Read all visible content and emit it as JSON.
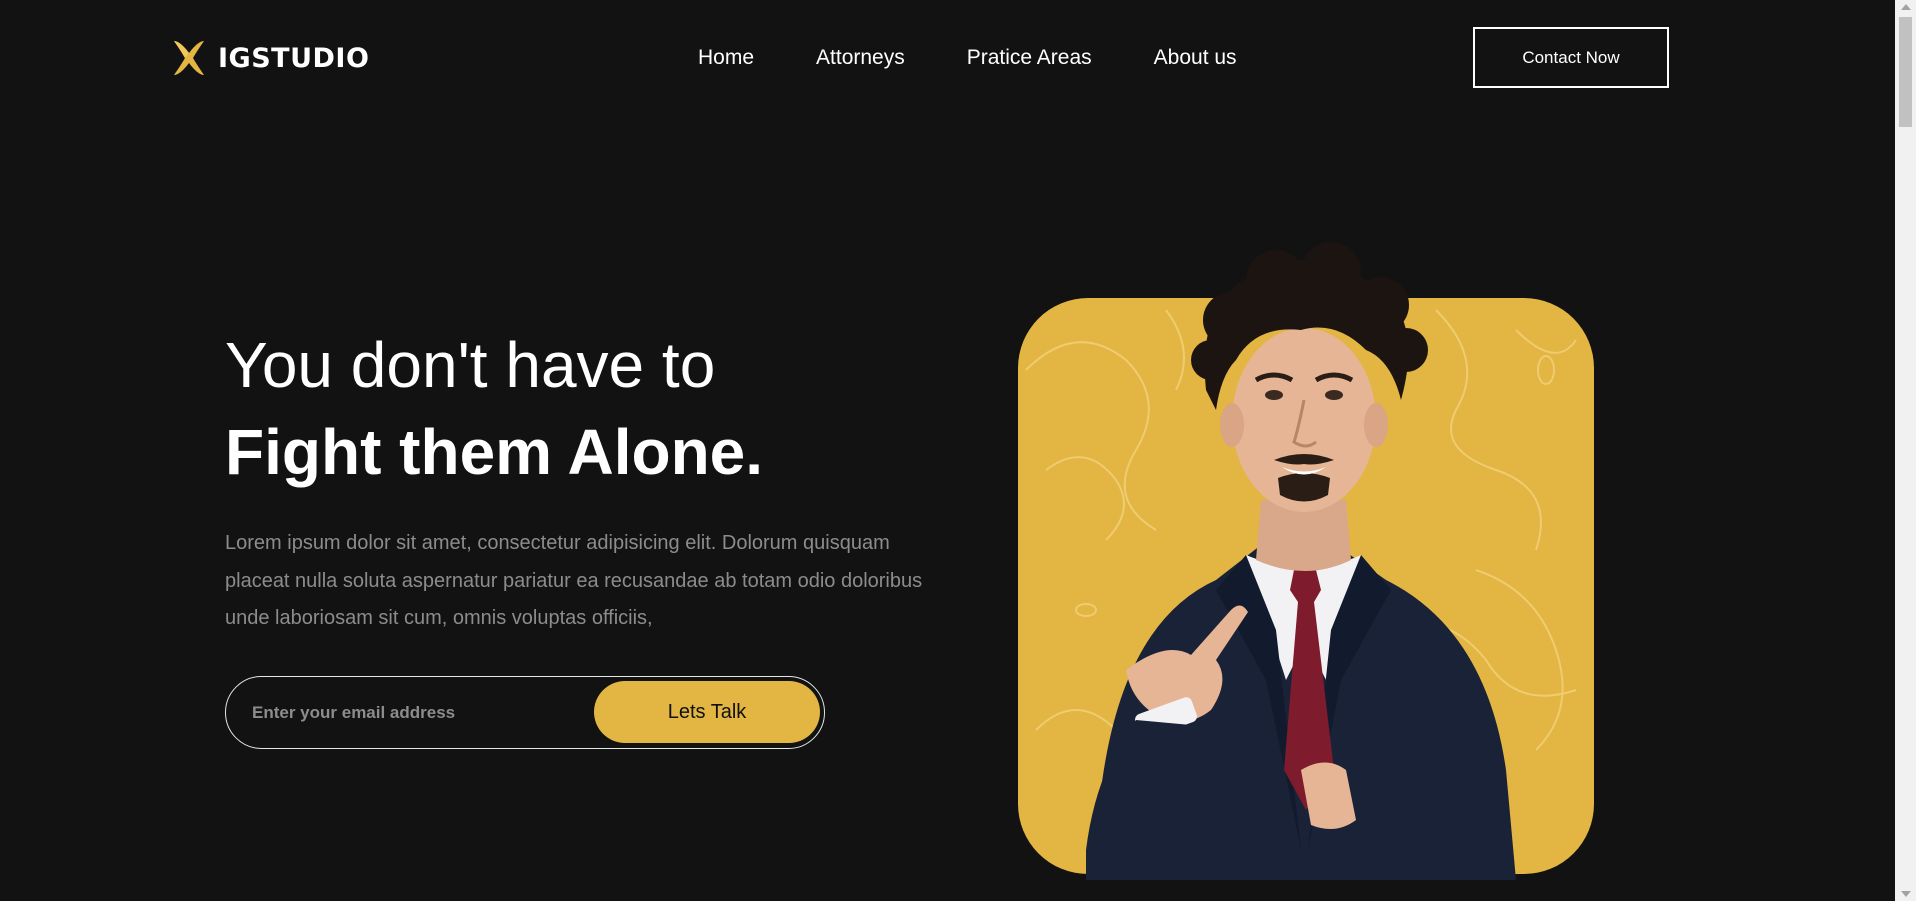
{
  "brand": {
    "name": "IGSTUDIO",
    "accent_color": "#e3b542"
  },
  "nav": {
    "items": [
      {
        "label": "Home"
      },
      {
        "label": "Attorneys"
      },
      {
        "label": "Pratice Areas"
      },
      {
        "label": "About us"
      }
    ],
    "contact_label": "Contact Now"
  },
  "hero": {
    "title_line1": "You don't have to",
    "title_line2": "Fight them Alone.",
    "description": "Lorem ipsum dolor sit amet, consectetur adipisicing elit. Dolorum quisquam placeat nulla soluta aspernatur pariatur ea recusandae ab totam odio doloribus unde laboriosam sit cum, omnis voluptas officiis,",
    "email_placeholder": "Enter your email address",
    "email_value": "",
    "cta_label": "Lets Talk",
    "image": "smiling man in dark suit and red tie pointing forward on yellow rounded backdrop"
  },
  "icons": {
    "logo": "x-logo-icon"
  },
  "colors": {
    "background": "#121212",
    "text": "#ffffff",
    "muted_text": "#8c8c8c",
    "accent": "#e3b542"
  }
}
